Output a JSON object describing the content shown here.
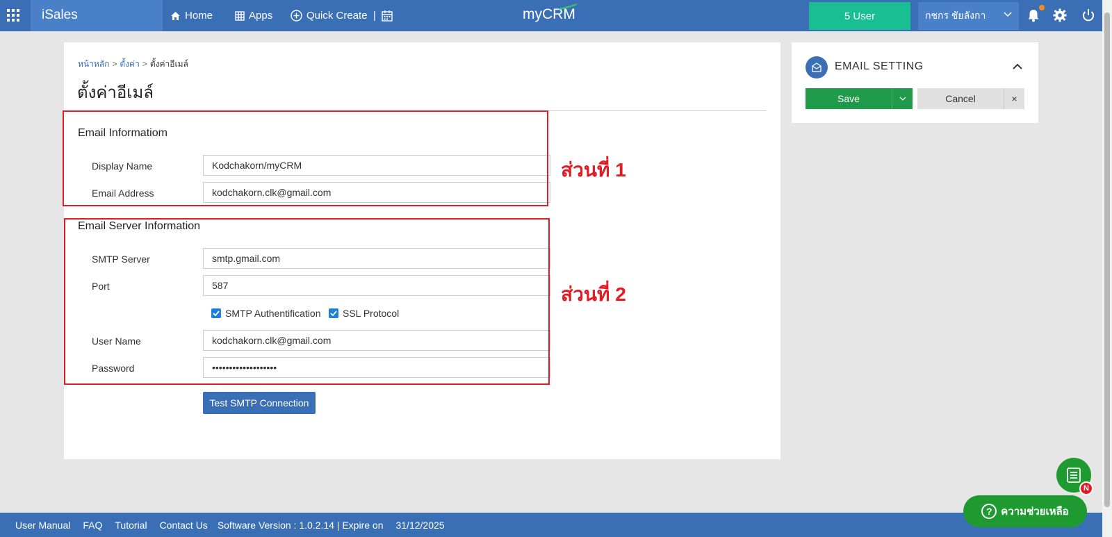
{
  "topbar": {
    "brand": "iSales",
    "nav": {
      "home": "Home",
      "apps": "Apps",
      "quick_create": "Quick Create",
      "sep": "|"
    },
    "logo": "myCRM",
    "users_label": "5 User",
    "user_name": "กชกร ชัยลังกา"
  },
  "breadcrumb": {
    "home": "หน้าหลัก",
    "settings": "ตั้งค่า",
    "current": "ตั้งค่าอีเมล์",
    "sep": ">"
  },
  "page_title": "ตั้งค่าอีเมล์",
  "email_info": {
    "title": "Email Informatiom",
    "display_name_label": "Display Name",
    "display_name_value": "Kodchakorn/myCRM",
    "email_label": "Email Address",
    "email_value": "kodchakorn.clk@gmail.com"
  },
  "server_info": {
    "title": "Email Server Information",
    "smtp_label": "SMTP Server",
    "smtp_value": "smtp.gmail.com",
    "port_label": "Port",
    "port_value": "587",
    "auth_label": "SMTP Authentification",
    "auth_checked": true,
    "ssl_label": "SSL Protocol",
    "ssl_checked": true,
    "username_label": "User Name",
    "username_value": "kodchakorn.clk@gmail.com",
    "password_label": "Password",
    "password_value": "•••••••••••••••••••",
    "test_button": "Test SMTP Connection"
  },
  "annotations": {
    "part1": "ส่วนที่ 1",
    "part2": "ส่วนที่ 2",
    "color": "#e31b23"
  },
  "right_panel": {
    "title": "EMAIL SETTING",
    "save": "Save",
    "cancel": "Cancel",
    "close": "×"
  },
  "footer": {
    "user_manual": "User Manual",
    "faq": "FAQ",
    "tutorial": "Tutorial",
    "contact": "Contact Us",
    "version": "Software Version : 1.0.2.14 | Expire on",
    "expire_date": "31/12/2025"
  },
  "floating": {
    "badge": "N",
    "help": "ความช่วยเหลือ"
  },
  "colors": {
    "primary": "#3a6fb5",
    "success": "#1f9a4a",
    "teal": "#19bf93"
  }
}
